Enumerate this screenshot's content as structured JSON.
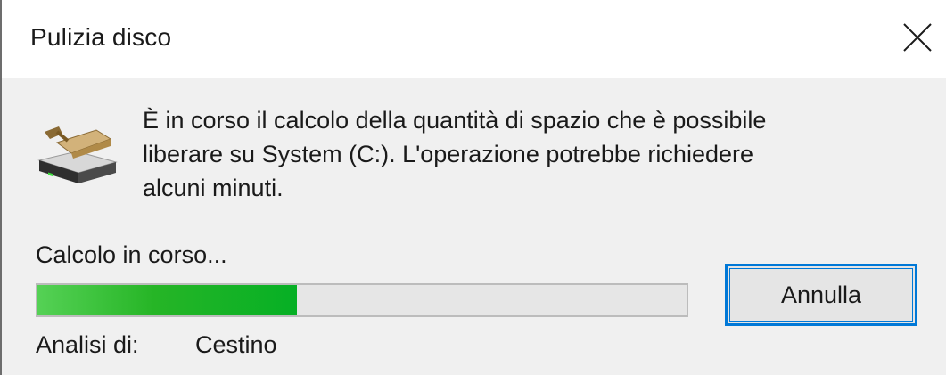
{
  "window": {
    "title": "Pulizia disco",
    "close_icon": "close-icon"
  },
  "content": {
    "message_line1": "È in corso il calcolo della quantità di spazio che è possibile",
    "message_line2": "liberare su System (C:). L'operazione potrebbe richiedere",
    "message_line3": "alcuni minuti.",
    "icon": "disk-cleanup-icon",
    "status": "Calcolo in corso...",
    "progress_fraction": 0.4,
    "progress_color": "#06b025",
    "cancel_label": "Annulla",
    "scan_label": "Analisi di:",
    "scan_value": "Cestino"
  },
  "colors": {
    "accent": "#0078d7",
    "dialog_bg": "#f0f0f0",
    "titlebar_bg": "#ffffff"
  }
}
